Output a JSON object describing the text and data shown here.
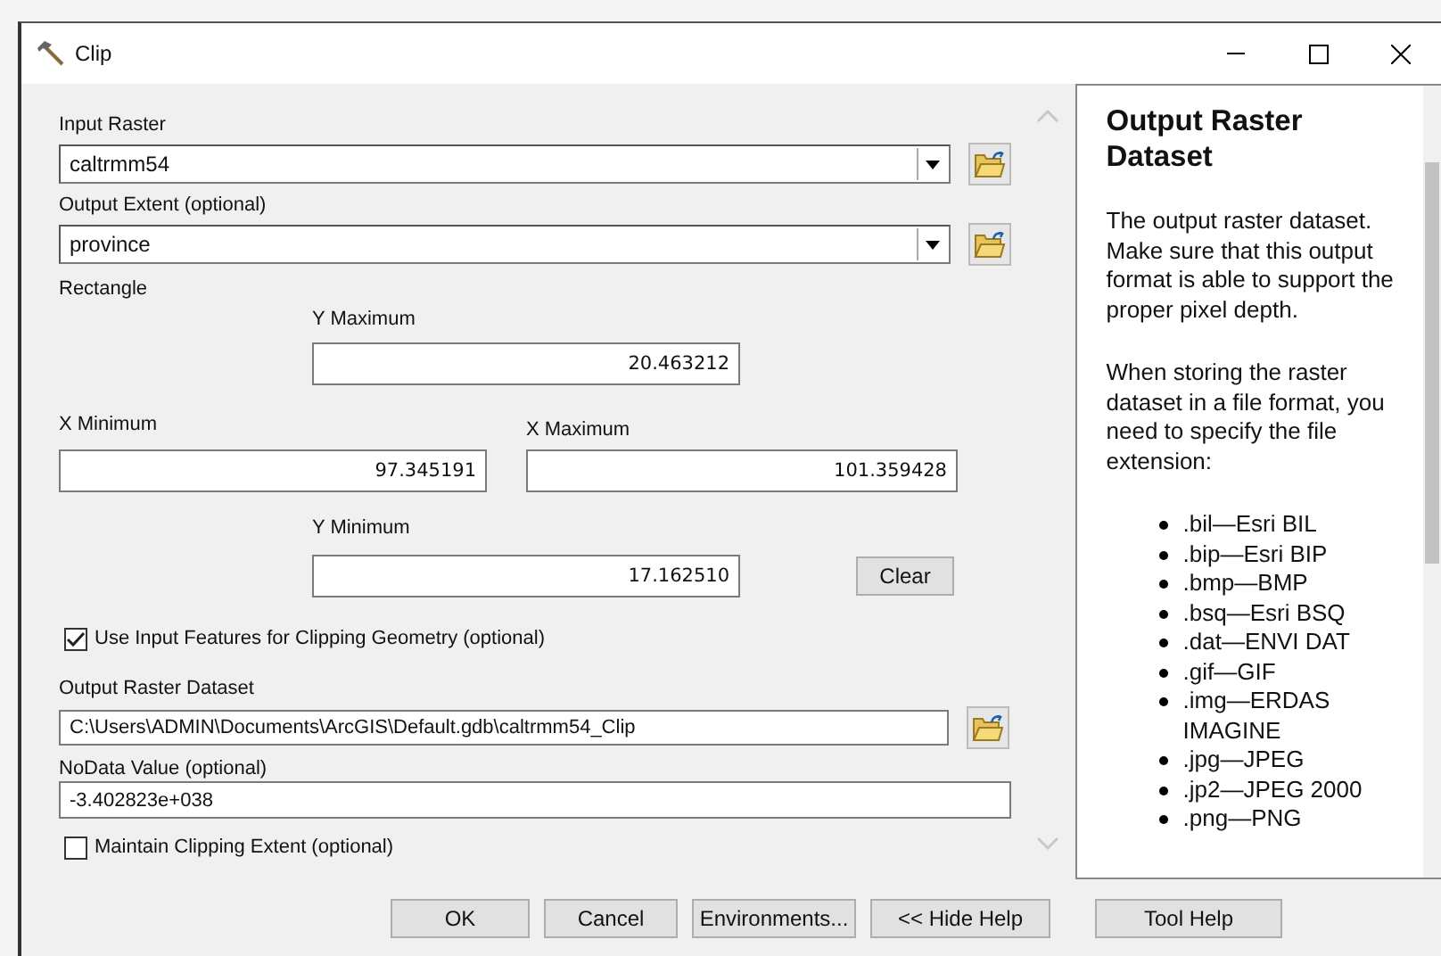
{
  "window": {
    "title": "Clip"
  },
  "input_raster": {
    "label": "Input Raster",
    "value": "caltrmm54"
  },
  "output_extent": {
    "label": "Output Extent (optional)",
    "value": "province"
  },
  "rectangle": {
    "label": "Rectangle",
    "y_maximum": {
      "label": "Y Maximum",
      "value": "20.463212"
    },
    "x_minimum": {
      "label": "X Minimum",
      "value": "97.345191"
    },
    "x_maximum": {
      "label": "X Maximum",
      "value": "101.359428"
    },
    "y_minimum": {
      "label": "Y Minimum",
      "value": "17.162510"
    },
    "clear_button": "Clear"
  },
  "use_input_features": {
    "label": "Use Input Features for Clipping Geometry (optional)",
    "checked": true
  },
  "output_raster_dataset": {
    "label": "Output Raster Dataset",
    "value": "C:\\Users\\ADMIN\\Documents\\ArcGIS\\Default.gdb\\caltrmm54_Clip"
  },
  "nodata_value": {
    "label": "NoData Value (optional)",
    "value": "-3.402823e+038"
  },
  "maintain_clipping_extent": {
    "label": "Maintain Clipping Extent (optional)",
    "checked": false
  },
  "help": {
    "title": "Output Raster Dataset",
    "paragraphs": [
      "The output raster dataset. Make sure that this output format is able to support the proper pixel depth.",
      "When storing the raster dataset in a file format, you need to specify the file extension:"
    ],
    "extensions": [
      ".bil—Esri BIL",
      ".bip—Esri BIP",
      ".bmp—BMP",
      ".bsq—Esri BSQ",
      ".dat—ENVI DAT",
      ".gif—GIF",
      ".img—ERDAS IMAGINE",
      ".jpg—JPEG",
      ".jp2—JPEG 2000",
      ".png—PNG"
    ]
  },
  "buttons": [
    "OK",
    "Cancel",
    "Environments...",
    "<< Hide Help",
    "Tool Help"
  ]
}
